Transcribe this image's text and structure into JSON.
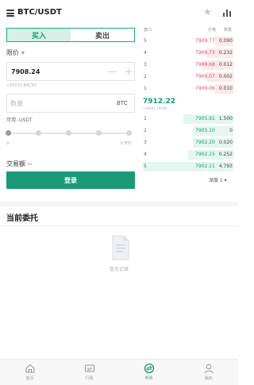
{
  "header": {
    "pair": "BTC/USDT",
    "icons": [
      "menu-icon",
      "star-icon",
      "chart-icon"
    ]
  },
  "trade": {
    "tabs": {
      "buy": "买入",
      "sell": "卖出"
    },
    "order_type": "限价",
    "price": "7908.24",
    "price_cny": "≈55015.84CNY",
    "amount_placeholder": "数量",
    "amount_unit": "BTC",
    "available": "可用 -USDT",
    "slider": {
      "min": "0",
      "max": "0 BTC",
      "value_percent": 0
    },
    "volume": "交易额 --",
    "buy_button": "登录"
  },
  "order_book": {
    "headers": {
      "index": "盘口",
      "price": "价格",
      "qty": "数量"
    },
    "asks": [
      {
        "index": "5",
        "price": "7909.77",
        "qty": "0.090",
        "depth_fraction": 0.2
      },
      {
        "index": "4",
        "price": "7909.73",
        "qty": "0.232",
        "depth_fraction": 0.3
      },
      {
        "index": "3",
        "price": "7909.68",
        "qty": "0.012",
        "depth_fraction": 0.35
      },
      {
        "index": "2",
        "price": "7909.07",
        "qty": "0.002",
        "depth_fraction": 0.3
      },
      {
        "index": "1",
        "price": "7909.06",
        "qty": "0.010",
        "depth_fraction": 0.2
      }
    ],
    "last_price": "7912.22",
    "last_price_cny": "≈55041.79CNY",
    "bids": [
      {
        "index": "1",
        "price": "7905.91",
        "qty": "1.500",
        "depth_fraction": 0.55
      },
      {
        "index": "2",
        "price": "7905.10",
        "qty": "0",
        "depth_fraction": 0.45
      },
      {
        "index": "3",
        "price": "7902.20",
        "qty": "0.020",
        "depth_fraction": 0.45
      },
      {
        "index": "4",
        "price": "7902.15",
        "qty": "0.252",
        "depth_fraction": 0.5
      },
      {
        "index": "5",
        "price": "7902.11",
        "qty": "4.793",
        "depth_fraction": 1.0
      }
    ],
    "depth": "深度 1"
  },
  "orders": {
    "title": "当前委托",
    "empty": "暂无记录"
  },
  "nav": {
    "items": [
      {
        "label": "首页",
        "icon": "home-icon",
        "active": false
      },
      {
        "label": "行情",
        "icon": "market-icon",
        "active": false
      },
      {
        "label": "币币",
        "icon": "trade-icon",
        "active": true
      },
      {
        "label": "我的",
        "icon": "profile-icon",
        "active": false
      }
    ]
  },
  "colors": {
    "accent": "#1a9a78",
    "ask": "#e0495c",
    "bid": "#1a9a78"
  }
}
